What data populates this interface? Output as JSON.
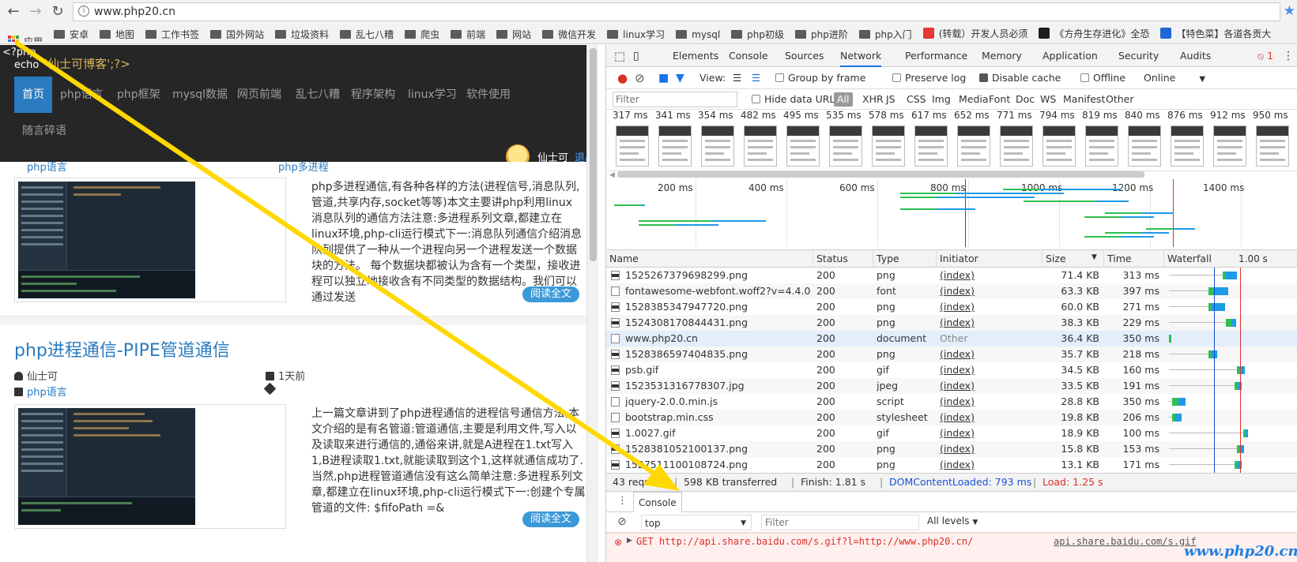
{
  "browser": {
    "url": "www.php20.cn",
    "bookmarks": [
      "应用",
      "安卓",
      "地图",
      "工作书签",
      "国外网站",
      "垃圾资料",
      "乱七八糟",
      "爬虫",
      "前端",
      "网站",
      "微信开发",
      "linux学习",
      "mysql",
      "php初级",
      "php进阶",
      "php入门",
      "(转载）开发人员必须",
      "《方舟生存进化》全恐",
      "【特色菜】各道各贡大"
    ]
  },
  "site": {
    "php_code": "<?php",
    "echo": "echo",
    "echo_str": "'仙士可博客';?>",
    "nav": [
      "首页",
      "php语言",
      "php框架",
      "mysql数据",
      "网页前端",
      "乱七八糟",
      "程序架构",
      "linux学习",
      "软件使用",
      "随言碎语"
    ],
    "user_name": "仙士可",
    "logout": "退出"
  },
  "posts": [
    {
      "partial_meta_left": "php语言",
      "partial_meta_right": "php多进程",
      "excerpt": "php多进程通信,有各种各样的方法(进程信号,消息队列,管道,共享内存,socket等等)本文主要讲php利用linux 消息队列的通信方法注意:多进程系列文章,都建立在linux环境,php-cli运行模式下一:消息队列通信介绍消息队列提供了一种从一个进程向另一个进程发送一个数据块的方法。 每个数据块都被认为含有一个类型，接收进程可以独立地接收含有不同类型的数据结构。我们可以通过发送",
      "readmore": "阅读全文"
    },
    {
      "title": "php进程通信-PIPE管道通信",
      "author": "仙士可",
      "time": "1天前",
      "category": "php语言",
      "excerpt": "上一篇文章讲到了php进程通信的进程信号通信方法,本文介绍的是有名管道:管道通信,主要是利用文件,写入以及读取来进行通信的,通俗来讲,就是A进程在1.txt写入1,B进程读取1.txt,就能读取到这个1,这样就通信成功了.当然,php进程管道通信没有这么简单注意:多进程系列文章,都建立在linux环境,php-cli运行模式下一:创建个专属管道的文件: $fifoPath =&",
      "readmore": "阅读全文"
    }
  ],
  "devtools": {
    "tabs": [
      "Elements",
      "Console",
      "Sources",
      "Network",
      "Performance",
      "Memory",
      "Application",
      "Security",
      "Audits"
    ],
    "active_tab": "Network",
    "error_count": "1",
    "toolbar": {
      "view": "View:",
      "group_by_frame": "Group by frame",
      "preserve_log": "Preserve log",
      "disable_cache": "Disable cache",
      "offline": "Offline",
      "throttle": "Online"
    },
    "filter": {
      "placeholder": "Filter",
      "hide_data_urls": "Hide data URLs",
      "types": [
        "All",
        "XHR",
        "JS",
        "CSS",
        "Img",
        "Media",
        "Font",
        "Doc",
        "WS",
        "Manifest",
        "Other"
      ]
    },
    "filmstrip_times": [
      "317 ms",
      "341 ms",
      "354 ms",
      "482 ms",
      "495 ms",
      "535 ms",
      "578 ms",
      "617 ms",
      "652 ms",
      "771 ms",
      "794 ms",
      "819 ms",
      "840 ms",
      "876 ms",
      "912 ms",
      "950 ms"
    ],
    "overview_ticks": [
      "200 ms",
      "400 ms",
      "600 ms",
      "800 ms",
      "1000 ms",
      "1200 ms",
      "1400 ms"
    ],
    "columns": [
      "Name",
      "Status",
      "Type",
      "Initiator",
      "Size",
      "Time",
      "Waterfall",
      "1.00 s"
    ],
    "requests": [
      {
        "name": "1525267379698299.png",
        "status": "200",
        "type": "png",
        "initiator": "(index)",
        "size": "71.4 KB",
        "time": "313 ms",
        "wf_start_ms": 950,
        "wf_wait_ms": 40,
        "wf_recv_ms": 150
      },
      {
        "name": "fontawesome-webfont.woff2?v=4.4.0",
        "status": "200",
        "type": "font",
        "initiator": "(index)",
        "size": "63.3 KB",
        "time": "397 ms",
        "wf_start_ms": 700,
        "wf_wait_ms": 60,
        "wf_recv_ms": 200
      },
      {
        "name": "1528385347947720.png",
        "status": "200",
        "type": "png",
        "initiator": "(index)",
        "size": "60.0 KB",
        "time": "271 ms",
        "wf_start_ms": 700,
        "wf_wait_ms": 40,
        "wf_recv_ms": 180
      },
      {
        "name": "1524308170844431.png",
        "status": "200",
        "type": "png",
        "initiator": "(index)",
        "size": "38.3 KB",
        "time": "229 ms",
        "wf_start_ms": 1000,
        "wf_wait_ms": 80,
        "wf_recv_ms": 60
      },
      {
        "name": "www.php20.cn",
        "status": "200",
        "type": "document",
        "initiator": "Other",
        "size": "36.4 KB",
        "time": "350 ms",
        "wf_start_ms": 0,
        "wf_wait_ms": 30,
        "wf_recv_ms": 0
      },
      {
        "name": "1528386597404835.png",
        "status": "200",
        "type": "png",
        "initiator": "(index)",
        "size": "35.7 KB",
        "time": "218 ms",
        "wf_start_ms": 700,
        "wf_wait_ms": 40,
        "wf_recv_ms": 70
      },
      {
        "name": "psb.gif",
        "status": "200",
        "type": "gif",
        "initiator": "(index)",
        "size": "34.5 KB",
        "time": "160 ms",
        "wf_start_ms": 1200,
        "wf_wait_ms": 40,
        "wf_recv_ms": 60
      },
      {
        "name": "1523531316778307.jpg",
        "status": "200",
        "type": "jpeg",
        "initiator": "(index)",
        "size": "33.5 KB",
        "time": "191 ms",
        "wf_start_ms": 1150,
        "wf_wait_ms": 40,
        "wf_recv_ms": 60
      },
      {
        "name": "jquery-2.0.0.min.js",
        "status": "200",
        "type": "script",
        "initiator": "(index)",
        "size": "28.8 KB",
        "time": "350 ms",
        "wf_start_ms": 60,
        "wf_wait_ms": 80,
        "wf_recv_ms": 100
      },
      {
        "name": "bootstrap.min.css",
        "status": "200",
        "type": "stylesheet",
        "initiator": "(index)",
        "size": "19.8 KB",
        "time": "206 ms",
        "wf_start_ms": 60,
        "wf_wait_ms": 40,
        "wf_recv_ms": 80
      },
      {
        "name": "1.0027.gif",
        "status": "200",
        "type": "gif",
        "initiator": "(index)",
        "size": "18.9 KB",
        "time": "100 ms",
        "wf_start_ms": 1300,
        "wf_wait_ms": 30,
        "wf_recv_ms": 40
      },
      {
        "name": "1528381052100137.png",
        "status": "200",
        "type": "png",
        "initiator": "(index)",
        "size": "15.8 KB",
        "time": "153 ms",
        "wf_start_ms": 1200,
        "wf_wait_ms": 40,
        "wf_recv_ms": 50
      },
      {
        "name": "1527511100108724.png",
        "status": "200",
        "type": "png",
        "initiator": "(index)",
        "size": "13.1 KB",
        "time": "171 ms",
        "wf_start_ms": 1150,
        "wf_wait_ms": 40,
        "wf_recv_ms": 60
      }
    ],
    "summary": {
      "requests": "43 requests",
      "transferred": "598 KB transferred",
      "finish": "Finish: 1.81 s",
      "dcl": "DOMContentLoaded: 793 ms",
      "load": "Load: 1.25 s"
    },
    "console": {
      "tab": "Console",
      "context": "top",
      "filter_placeholder": "Filter",
      "levels": "All levels",
      "error_msg": "GET http://api.share.baidu.com/s.gif?l=http://www.php20.cn/",
      "error_src": "api.share.baidu.com/s.gif"
    }
  },
  "watermark": "www.php20.cn",
  "colors": {
    "accent": "#2a7bbf",
    "nav_bg": "#262626",
    "annotation_arrow": "#ffd800",
    "wf_wait": "#2ec052",
    "wf_recv": "#1e9be8",
    "dcl_line": "#1a4fd6",
    "load_line": "#e03030"
  }
}
